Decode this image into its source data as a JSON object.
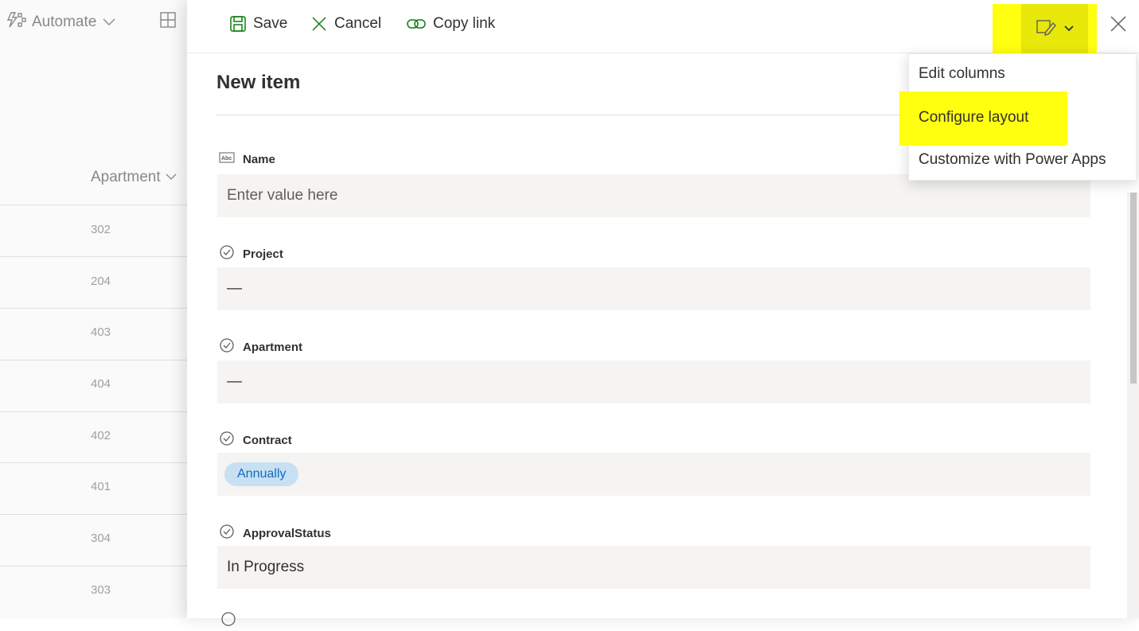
{
  "background": {
    "automate_label": "Automate",
    "column_header": "Apartment",
    "rows": [
      "302",
      "204",
      "403",
      "404",
      "402",
      "401",
      "304",
      "303"
    ]
  },
  "commandbar": {
    "save_label": "Save",
    "cancel_label": "Cancel",
    "copy_link_label": "Copy link"
  },
  "form": {
    "title": "New item",
    "fields": [
      {
        "label": "Name",
        "icon": "text-field-icon",
        "placeholder": "Enter value here"
      },
      {
        "label": "Project",
        "icon": "check-circle-icon",
        "value": "—"
      },
      {
        "label": "Apartment",
        "icon": "check-circle-icon",
        "value": "—"
      },
      {
        "label": "Contract",
        "icon": "check-circle-icon",
        "value": "Annually"
      },
      {
        "label": "ApprovalStatus",
        "icon": "check-circle-icon",
        "value": "In Progress"
      }
    ]
  },
  "menu": {
    "items": [
      "Edit columns",
      "Configure layout",
      "Customize with Power Apps"
    ]
  },
  "colors": {
    "highlight": "#ffff0f",
    "pill_bg": "#c7e0f4",
    "pill_text": "#0f6cbd",
    "field_bg": "#f5f4f2",
    "accent_green": "#107c10"
  }
}
